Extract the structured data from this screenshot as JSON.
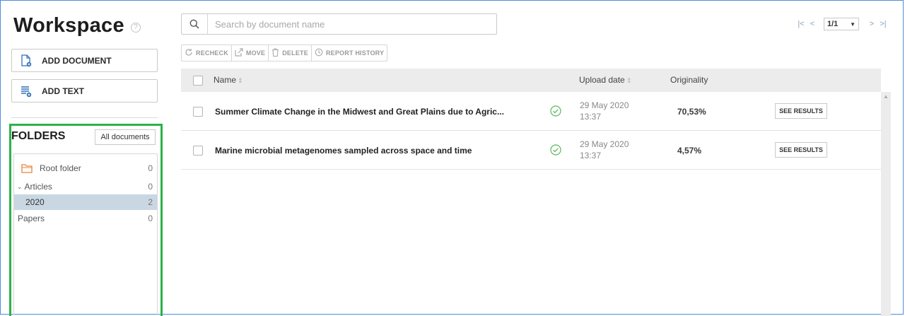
{
  "sidebar": {
    "title": "Workspace",
    "help_glyph": "?",
    "add_document": "ADD DOCUMENT",
    "add_text": "ADD TEXT",
    "folders_title": "FOLDERS",
    "all_documents": "All documents",
    "folders": [
      {
        "label": "Root folder",
        "count": "0"
      },
      {
        "label": "Articles",
        "count": "0"
      },
      {
        "label": "2020",
        "count": "2"
      },
      {
        "label": "Papers",
        "count": "0"
      }
    ]
  },
  "search": {
    "placeholder": "Search by document name"
  },
  "pager": {
    "current": "1/1"
  },
  "toolbar": {
    "recheck": "RECHECK",
    "move": "MOVE",
    "delete": "DELETE",
    "report_history": "REPORT HISTORY"
  },
  "table": {
    "col_name": "Name",
    "col_upload": "Upload date",
    "col_originality": "Originality",
    "rows": [
      {
        "name": "Summer Climate Change in the Midwest and Great Plains due to Agric...",
        "date": "29 May 2020",
        "time": "13:37",
        "originality": "70,53%",
        "action": "SEE RESULTS"
      },
      {
        "name": "Marine microbial metagenomes sampled across space and time",
        "date": "29 May 2020",
        "time": "13:37",
        "originality": "4,57%",
        "action": "SEE RESULTS"
      }
    ]
  },
  "colors": {
    "accent_green": "#2db24a",
    "selection": "#c9d7e3",
    "check_green": "#5cb85c",
    "folder_orange": "#e8833a"
  }
}
